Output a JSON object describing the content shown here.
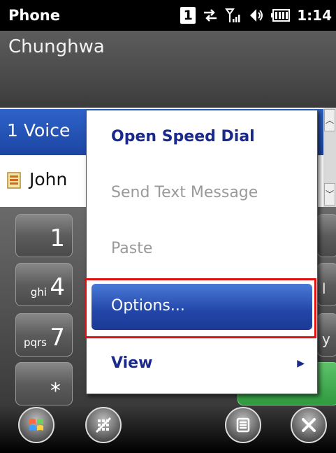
{
  "status_bar": {
    "app_title": "Phone",
    "sim_badge": "1",
    "clock": "1:14",
    "icons": [
      "sim-slot-icon",
      "data-transfer-icon",
      "signal-strength-icon",
      "speaker-icon",
      "battery-icon"
    ]
  },
  "carrier": "Chunghwa",
  "call_list": [
    {
      "label": "1  Voice"
    },
    {
      "label": "John"
    }
  ],
  "dialpad": {
    "keys": [
      {
        "num": "1",
        "letters": ""
      },
      {
        "num": "4",
        "letters": "ghi"
      },
      {
        "num": "7",
        "letters": "pqrs"
      },
      {
        "num": "*",
        "letters": ""
      }
    ],
    "right_partial": [
      "l",
      "y"
    ]
  },
  "menu": {
    "items": [
      {
        "label": "Open Speed Dial",
        "enabled": true
      },
      {
        "label": "Send Text Message",
        "enabled": false
      },
      {
        "label": "Paste",
        "enabled": false
      },
      {
        "label": "Options...",
        "enabled": true,
        "selected": true
      },
      {
        "label": "View",
        "enabled": true,
        "has_submenu": true
      }
    ]
  },
  "bottom_bar": {
    "buttons": [
      "windows-start-icon",
      "keypad-toggle-icon",
      "menu-icon",
      "close-icon"
    ]
  },
  "colors": {
    "selection_blue": "#2246a8",
    "highlight_red": "#e01010",
    "menu_text": "#1a2a8a",
    "call_green": "#2f9a3f"
  }
}
